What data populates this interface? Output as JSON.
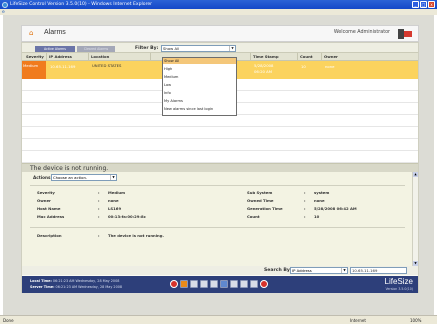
{
  "window": {
    "title": "LifeSize Control Version 3.5.0(10) - Windows Internet Explorer",
    "minimize": "_",
    "maximize": "□",
    "close": "x"
  },
  "header": {
    "page_title": "Alarms",
    "welcome": "Welcome Administrator",
    "home_icon": "home-icon",
    "logout_icon": "logout-icon"
  },
  "tabs": [
    "Active Alarms",
    "Cleared Alarms"
  ],
  "filter": {
    "label": "Filter By:",
    "selected": "Show All",
    "options": [
      "Show All",
      "High",
      "Medium",
      "Low",
      "Info",
      "My Alarms",
      "New alarms since last login"
    ],
    "highlighted_index": 0
  },
  "table": {
    "columns": [
      "Severity",
      "IP Address",
      "Location",
      "",
      "Time Stamp",
      "Count",
      "Owner"
    ],
    "rows": [
      {
        "severity": "Medium",
        "ip": "10.65.11.169",
        "location": "UNITED STATES",
        "date": "5/28/2008",
        "time": "06:20 AM",
        "count": "10",
        "owner": "none"
      }
    ]
  },
  "status_message": "The device is not running.",
  "actions": {
    "label": "Actions:",
    "placeholder": "Choose an action."
  },
  "details": {
    "left": [
      {
        "label": "Severity",
        "value": "Medium"
      },
      {
        "label": "Owner",
        "value": "none"
      },
      {
        "label": "Host Name",
        "value": "LS169"
      },
      {
        "label": "Mac Address",
        "value": "00:13:fa:00:29:8c"
      }
    ],
    "right": [
      {
        "label": "Sub System",
        "value": "system"
      },
      {
        "label": "Owned Time",
        "value": "none"
      },
      {
        "label": "Generation Time",
        "value": "5/28/2008 06:42 AM"
      },
      {
        "label": "Count",
        "value": "10"
      }
    ],
    "description_label": "Description",
    "description_value": "The device is not running."
  },
  "search": {
    "label": "Search By:",
    "field": "IP Address",
    "value": "10.65.11.169"
  },
  "footer": {
    "local_time_label": "Local Time:",
    "local_time_value": "06:21:23 AM Wednesday, 28 May 2008",
    "server_time_label": "Server Time:",
    "server_time_value": "06:21:23 AM Wednesday, 28 May 2008",
    "logo": "LifeSize",
    "version": "Version 3.5.0(10)"
  },
  "ie_status": {
    "left": "Done",
    "zone": "Internet",
    "zoom": "100%"
  }
}
